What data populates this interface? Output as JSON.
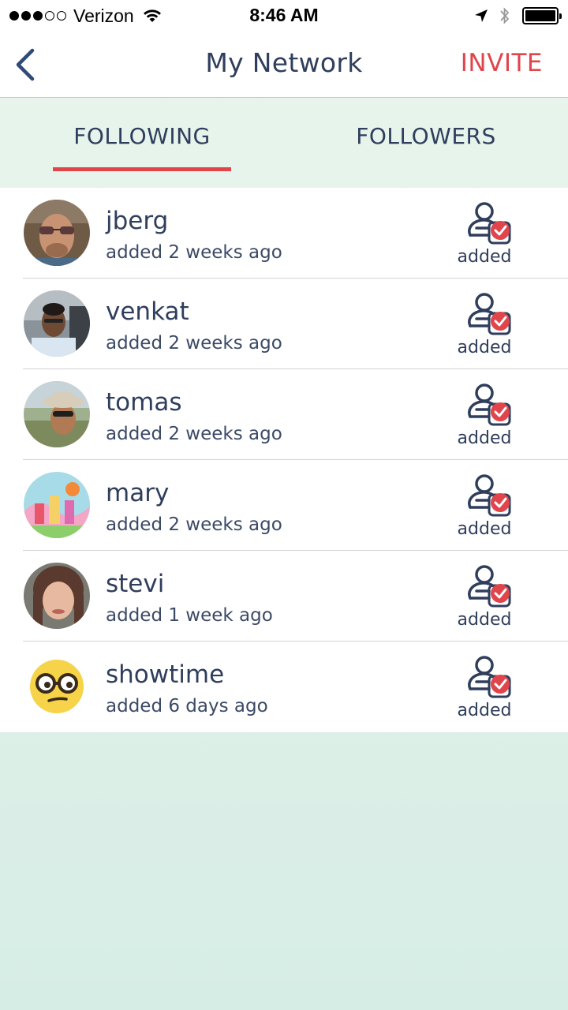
{
  "status_bar": {
    "carrier": "Verizon",
    "time": "8:46 AM",
    "signal_bars_filled": 3,
    "signal_bars_total": 5
  },
  "nav": {
    "title": "My Network",
    "invite_label": "INVITE",
    "back_icon": "chevron-left-icon"
  },
  "tabs": [
    {
      "label": "FOLLOWING",
      "active": true
    },
    {
      "label": "FOLLOWERS",
      "active": false
    }
  ],
  "colors": {
    "accent": "#e0454b",
    "text": "#2f3e5c",
    "background": "#e3f3ea"
  },
  "users": [
    {
      "name": "jberg",
      "subtitle": "added 2 weeks ago",
      "status": "added",
      "avatar": "photo-avatar"
    },
    {
      "name": "venkat",
      "subtitle": "added 2 weeks ago",
      "status": "added",
      "avatar": "photo-avatar"
    },
    {
      "name": "tomas",
      "subtitle": "added 2 weeks ago",
      "status": "added",
      "avatar": "photo-avatar"
    },
    {
      "name": "mary",
      "subtitle": "added 2 weeks ago",
      "status": "added",
      "avatar": "illustration-avatar"
    },
    {
      "name": "stevi",
      "subtitle": "added 1 week ago",
      "status": "added",
      "avatar": "photo-avatar"
    },
    {
      "name": "showtime",
      "subtitle": "added 6 days ago",
      "status": "added",
      "avatar": "nerd-emoji-avatar"
    }
  ]
}
